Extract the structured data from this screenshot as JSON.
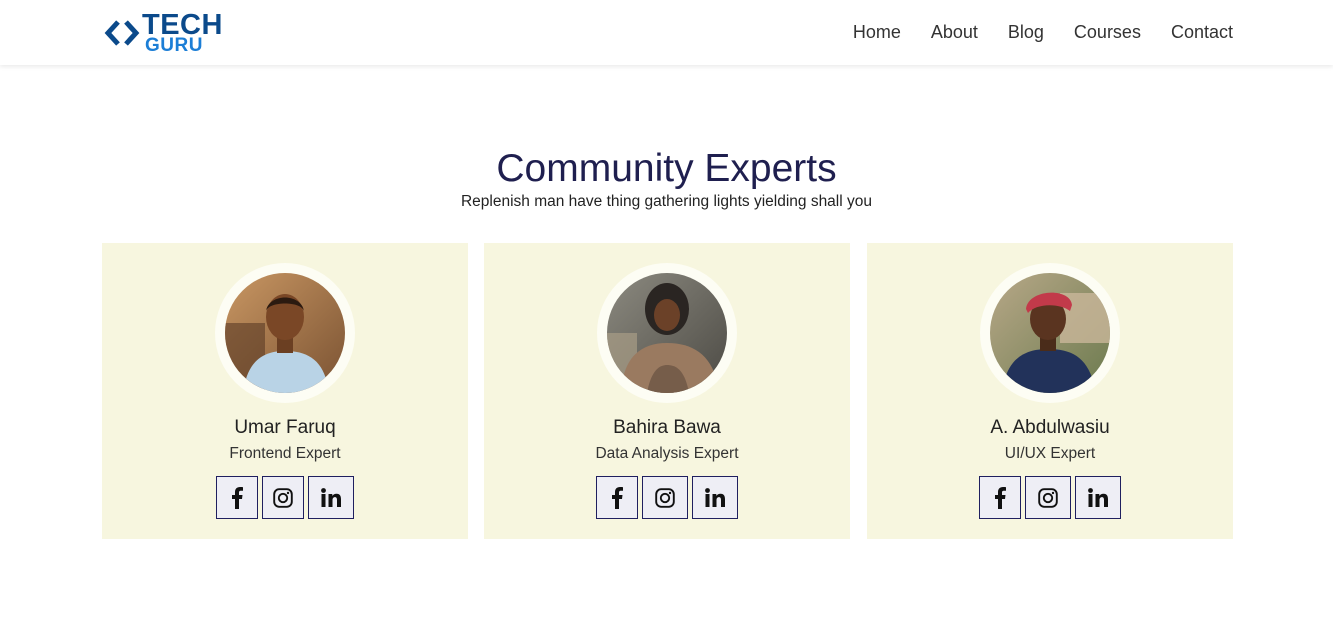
{
  "brand": {
    "line1": "TECH",
    "line2": "GURU"
  },
  "nav": [
    "Home",
    "About",
    "Blog",
    "Courses",
    "Contact"
  ],
  "section": {
    "title": "Community Experts",
    "subtitle": "Replenish man have thing gathering lights yielding shall you"
  },
  "experts": [
    {
      "name": "Umar Faruq",
      "role": "Frontend Expert",
      "socials": [
        "facebook-icon",
        "instagram-icon",
        "linkedin-icon"
      ]
    },
    {
      "name": "Bahira Bawa",
      "role": "Data Analysis Expert",
      "socials": [
        "facebook-icon",
        "instagram-icon",
        "linkedin-icon"
      ]
    },
    {
      "name": "A. Abdulwasiu",
      "role": "UI/UX Expert",
      "socials": [
        "facebook-icon",
        "instagram-icon",
        "linkedin-icon"
      ]
    }
  ],
  "colors": {
    "brand_dark": "#0b4a8b",
    "brand_light": "#1c7ed6",
    "title": "#1f1f4f",
    "card_bg": "#f7f6df",
    "icon_border": "#1f1f5f"
  }
}
